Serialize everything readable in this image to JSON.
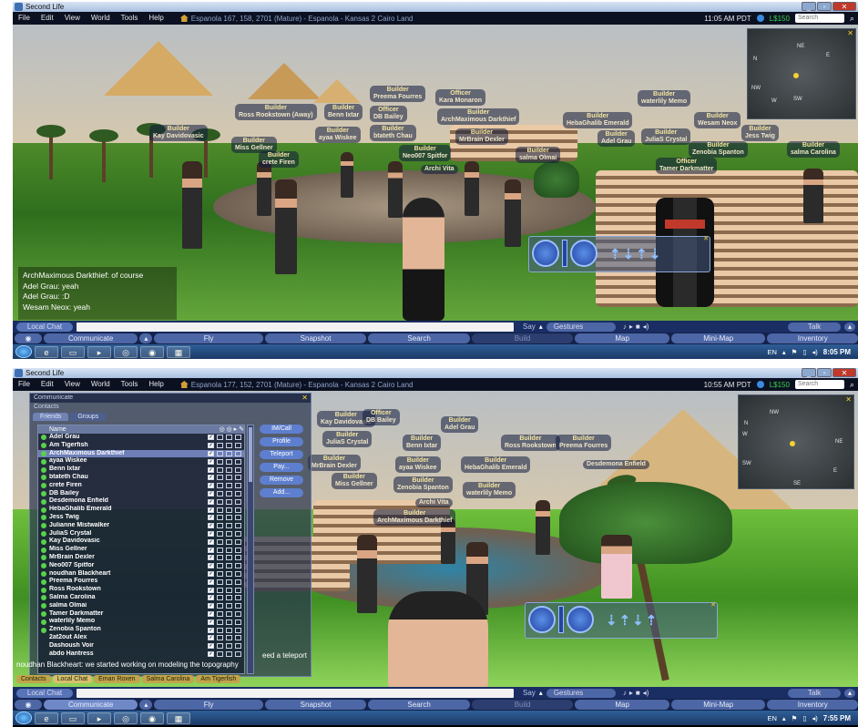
{
  "colors": {
    "titlebar": "#a9c0df",
    "menubar": "#0c1122",
    "money": "#39d14b",
    "buttons": "#4d66a5",
    "taskbar": "#1c3a66",
    "tag_text": "#f0e6c8"
  },
  "shotA": {
    "window_title": "Second Life",
    "menu": [
      "File",
      "Edit",
      "View",
      "World",
      "Tools",
      "Help"
    ],
    "location": "Espanola 167, 158, 2701 (Mature) - Espanola - Kansas 2 Cairo Land",
    "time": "11:05 AM PDT",
    "money": "L$150",
    "search_placeholder": "Search",
    "minimap_dirs": [
      "NE",
      "N",
      "E",
      "NW",
      "SW",
      "W"
    ],
    "tags": [
      {
        "role": "Builder",
        "name": "Preema Fourres"
      },
      {
        "role": "Officer",
        "name": "Kara Monaron"
      },
      {
        "role": "Builder",
        "name": "Ross Rookstown (Away)"
      },
      {
        "role": "Builder",
        "name": "Benn Ixtar"
      },
      {
        "role": "Officer",
        "name": "DB Bailey"
      },
      {
        "role": "Builder",
        "name": "ArchMaximous Darkthief"
      },
      {
        "role": "Builder",
        "name": "HebaGhalib Emerald"
      },
      {
        "role": "Builder",
        "name": "waterlily Memo"
      },
      {
        "role": "Builder",
        "name": "Wesam Neox"
      },
      {
        "role": "Builder",
        "name": "Kay Davidovasic"
      },
      {
        "role": "Builder",
        "name": "Miss Gellner"
      },
      {
        "role": "Builder",
        "name": "ayaa Wiskee"
      },
      {
        "role": "Builder",
        "name": "btateth Chau"
      },
      {
        "role": "Builder",
        "name": "MrBrain Dexler"
      },
      {
        "role": "Builder",
        "name": "Adel Grau"
      },
      {
        "role": "Builder",
        "name": "JuliaS Crystal"
      },
      {
        "role": "Builder",
        "name": "Jess Twig"
      },
      {
        "role": "Builder",
        "name": "crete Firen"
      },
      {
        "role": "Builder",
        "name": "Neo007 Spitfor"
      },
      {
        "role": "Builder",
        "name": "salma Olmai"
      },
      {
        "role": "Builder",
        "name": "Zenobia Spanton"
      },
      {
        "role": "Builder",
        "name": "salma Carolina"
      },
      {
        "role": "Officer",
        "name": "Tamer Darkmatter"
      },
      {
        "role": "",
        "name": "Archi Vita"
      }
    ],
    "chat": [
      "ArchMaximous Darkthief: of course",
      "Adel Grau: yeah",
      "Adel Grau: :D",
      "Wesam Neox: yeah"
    ],
    "tray_lang": "EN",
    "clock": "8:05 PM"
  },
  "shotB": {
    "window_title": "Second Life",
    "menu": [
      "File",
      "Edit",
      "View",
      "World",
      "Tools",
      "Help"
    ],
    "location": "Espanola 177, 152, 2701 (Mature) - Espanola - Kansas 2 Cairo Land",
    "time": "10:55 AM PDT",
    "money": "L$150",
    "search_placeholder": "Search",
    "minimap_dirs": [
      "NW",
      "N",
      "NE",
      "W",
      "SW",
      "E",
      "SE"
    ],
    "communicate_title": "Communicate",
    "contacts_label": "Contacts",
    "tabs": [
      "Friends",
      "Groups"
    ],
    "list_header": "Name",
    "friends": [
      "Adel Grau",
      "Am Tigerfish",
      "ArchMaximous Darkthief",
      "ayaa Wiskee",
      "Benn Ixtar",
      "btateth Chau",
      "crete Firen",
      "DB Bailey",
      "Desdemona Enfield",
      "HebaGhalib Emerald",
      "Jess Twig",
      "Julianne Mistwalker",
      "JuliaS Crystal",
      "Kay Davidovasic",
      "Miss Gellner",
      "MrBrain Dexler",
      "Neo007 Spitfor",
      "noudhan Blackheart",
      "Preema Fourres",
      "Ross Rookstown",
      "Salma Carolina",
      "salma Olmai",
      "Tamer Darkmatter",
      "waterlily Memo",
      "Zenobia Spanton",
      "2at2out Alex",
      "Dashoush Voir",
      "abdo Hantress"
    ],
    "friend_buttons": [
      "IM/Call",
      "Profile",
      "Teleport",
      "Pay...",
      "Remove",
      "Add..."
    ],
    "tags": [
      {
        "role": "Builder",
        "name": "Kay Davidovasic"
      },
      {
        "role": "Officer",
        "name": "DB Bailey"
      },
      {
        "role": "Builder",
        "name": "Adel Grau"
      },
      {
        "role": "Builder",
        "name": "JuliaS Crystal"
      },
      {
        "role": "Builder",
        "name": "Benn Ixtar"
      },
      {
        "role": "Builder",
        "name": "Ross Rookstown"
      },
      {
        "role": "Builder",
        "name": "Preema Fourres"
      },
      {
        "role": "Builder",
        "name": "MrBrain Dexler"
      },
      {
        "role": "Builder",
        "name": "ayaa Wiskee"
      },
      {
        "role": "Builder",
        "name": "HebaGhalib Emerald"
      },
      {
        "role": "Builder",
        "name": "Miss Gellner"
      },
      {
        "role": "Builder",
        "name": "Zenobia Spanton"
      },
      {
        "role": "Builder",
        "name": "waterlily Memo"
      },
      {
        "role": "",
        "name": "Archi Vita"
      },
      {
        "role": "Builder",
        "name": "ArchMaximous Darkthief"
      },
      {
        "role": "",
        "name": "Desdemona Enfield"
      }
    ],
    "chat_line": "noudhan Blackheart: we started working on modeling the topography",
    "chat_tail": "eed a teleport",
    "chat_tabs": [
      "Contacts",
      "Local Chat",
      "Eman Roxen",
      "Salma Carolina",
      "Am Tigerfish"
    ],
    "tray_lang": "EN",
    "clock": "7:55 PM"
  },
  "bottom": {
    "local_chat": "Local Chat",
    "say": "Say",
    "gestures": "Gestures",
    "talk": "Talk",
    "buttons": [
      "Communicate",
      "Fly",
      "Snapshot",
      "Search",
      "Build",
      "Map",
      "Mini-Map",
      "Inventory"
    ]
  }
}
